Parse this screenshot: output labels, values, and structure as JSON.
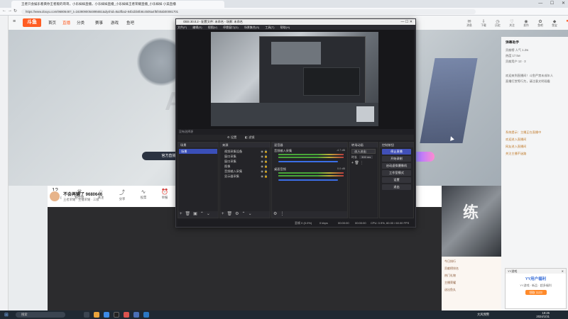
{
  "browser": {
    "tab_title": "王者只会娱乐看黄你王者版的哥哥，小乐妹妹直播，小乐妹妹直播_小乐妹妹王者荣耀直播_小乐妹妹 小美直播",
    "url": "https://www.douyu.com/9680646?_t=1639090054895651&dyshid=8a3fba2-84b1bb0b8c4505a4f5f40ab00081701",
    "window_controls": [
      "—",
      "☐",
      "✕"
    ]
  },
  "site": {
    "logo": "斗鱼",
    "nav": [
      "首页",
      "直播",
      "分类",
      "赛事",
      "游戏",
      "鱼吧"
    ],
    "top_icons": [
      "消息",
      "下载",
      "历史",
      "关注",
      "发作",
      "鱼吧",
      "鱼宝",
      "关注",
      "历史"
    ],
    "hero_text": "A",
    "official_button": "官方直播间"
  },
  "streamer": {
    "title": "不会再输了 9680646",
    "sub": "王者荣耀 · 主播荣耀 · 三级",
    "fans_count": "12",
    "fans_label": "我的粉丝",
    "actions": [
      "粉丝团",
      "关注",
      "分享",
      "投票",
      "举报",
      "设置",
      "主播"
    ]
  },
  "right_panel": {
    "title": "弹幕助手",
    "lines": [
      "贡献榜     人气 1.2w",
      "热度 17.5w",
      "贡献用户 12 · 3",
      "",
      "欢迎来到直播间！斗鱼严禁未成年人",
      "直播打赏等行为，请注意文明观看",
      "",
      "系统提示：主播正在直播中",
      "欢迎进入直播间",
      "网友进入直播间",
      "关注主播不迷路"
    ]
  },
  "poster": {
    "char": "练"
  },
  "right_lower": {
    "lines": [
      "今日排行",
      "贡献榜排名",
      "热门礼物",
      "主播荣耀",
      "送出鱼丸"
    ]
  },
  "obs": {
    "title": "OBS 30.0.2 - 配置文件: 未命名 - 场景: 未命名",
    "menu": [
      "文件(F)",
      "编辑(E)",
      "视图(V)",
      "停靠窗口(D)",
      "场景集合(S)",
      "工具(T)",
      "帮助(H)"
    ],
    "no_source": "没有选择源",
    "toolbar_props": "⚙ 设置",
    "toolbar_filter": "◧ 滤镜",
    "docks": {
      "scenes": {
        "title": "场景",
        "items": [
          "场景"
        ]
      },
      "sources": {
        "title": "来源",
        "items": [
          "视频采集设备",
          "窗口采集",
          "窗口采集",
          "图像",
          "音频输入采集",
          "显示器采集"
        ]
      },
      "mixer": {
        "title": "混音器",
        "channels": [
          {
            "name": "音频输入采集",
            "db": "-4.7 dB"
          },
          {
            "name": "桌面音频",
            "db": "0.0 dB"
          }
        ]
      },
      "transitions": {
        "title": "转场动画",
        "selected": "淡入淡出",
        "duration_label": "时长",
        "duration": "300 ms"
      },
      "controls": {
        "title": "控制按钮",
        "buttons": [
          "停止直播",
          "开始录制",
          "启动虚拟摄像机",
          "工作室模式",
          "设置",
          "退出"
        ]
      }
    },
    "status": {
      "frames": "丢帧 0 (0.0%)",
      "bitrate": "0 kbps",
      "live_time": "00:00:00",
      "rec_time": "00:00:00",
      "cpu": "CPU: 0.9%, 60.00 / 60.00 FPS"
    }
  },
  "notification": {
    "head": "YY游戏",
    "title": "YY用户福利",
    "body": "YY游戏 · 新品 · 超多福利",
    "button": "领取 1123"
  },
  "taskbar": {
    "search_placeholder": "搜索",
    "weather": "大风预警",
    "time": "19:25",
    "date": "2024/1/31"
  }
}
